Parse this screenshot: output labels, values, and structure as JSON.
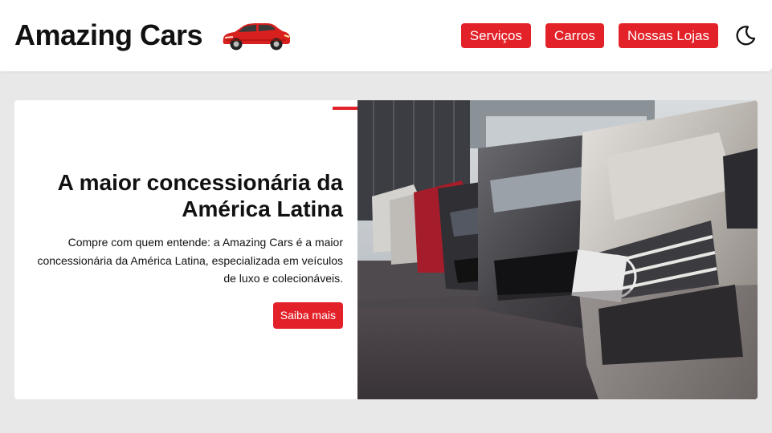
{
  "header": {
    "brand": "Amazing Cars",
    "logo_icon": "red-car-icon",
    "nav": [
      {
        "label": "Serviços"
      },
      {
        "label": "Carros"
      },
      {
        "label": "Nossas Lojas"
      }
    ],
    "theme_icon": "moon-icon"
  },
  "hero": {
    "title": "A maior concessionária da América Latina",
    "description": "Compre com quem entende: a Amazing Cars é a maior concessionária da América Latina, especializada em veículos de luxo e colecionáveis.",
    "button_label": "Saiba mais",
    "image_subject": "row-of-parked-luxury-cars-photo"
  },
  "colors": {
    "accent": "#e32128",
    "page_bg": "#e8e8e8",
    "card_bg": "#ffffff",
    "text": "#111111"
  }
}
